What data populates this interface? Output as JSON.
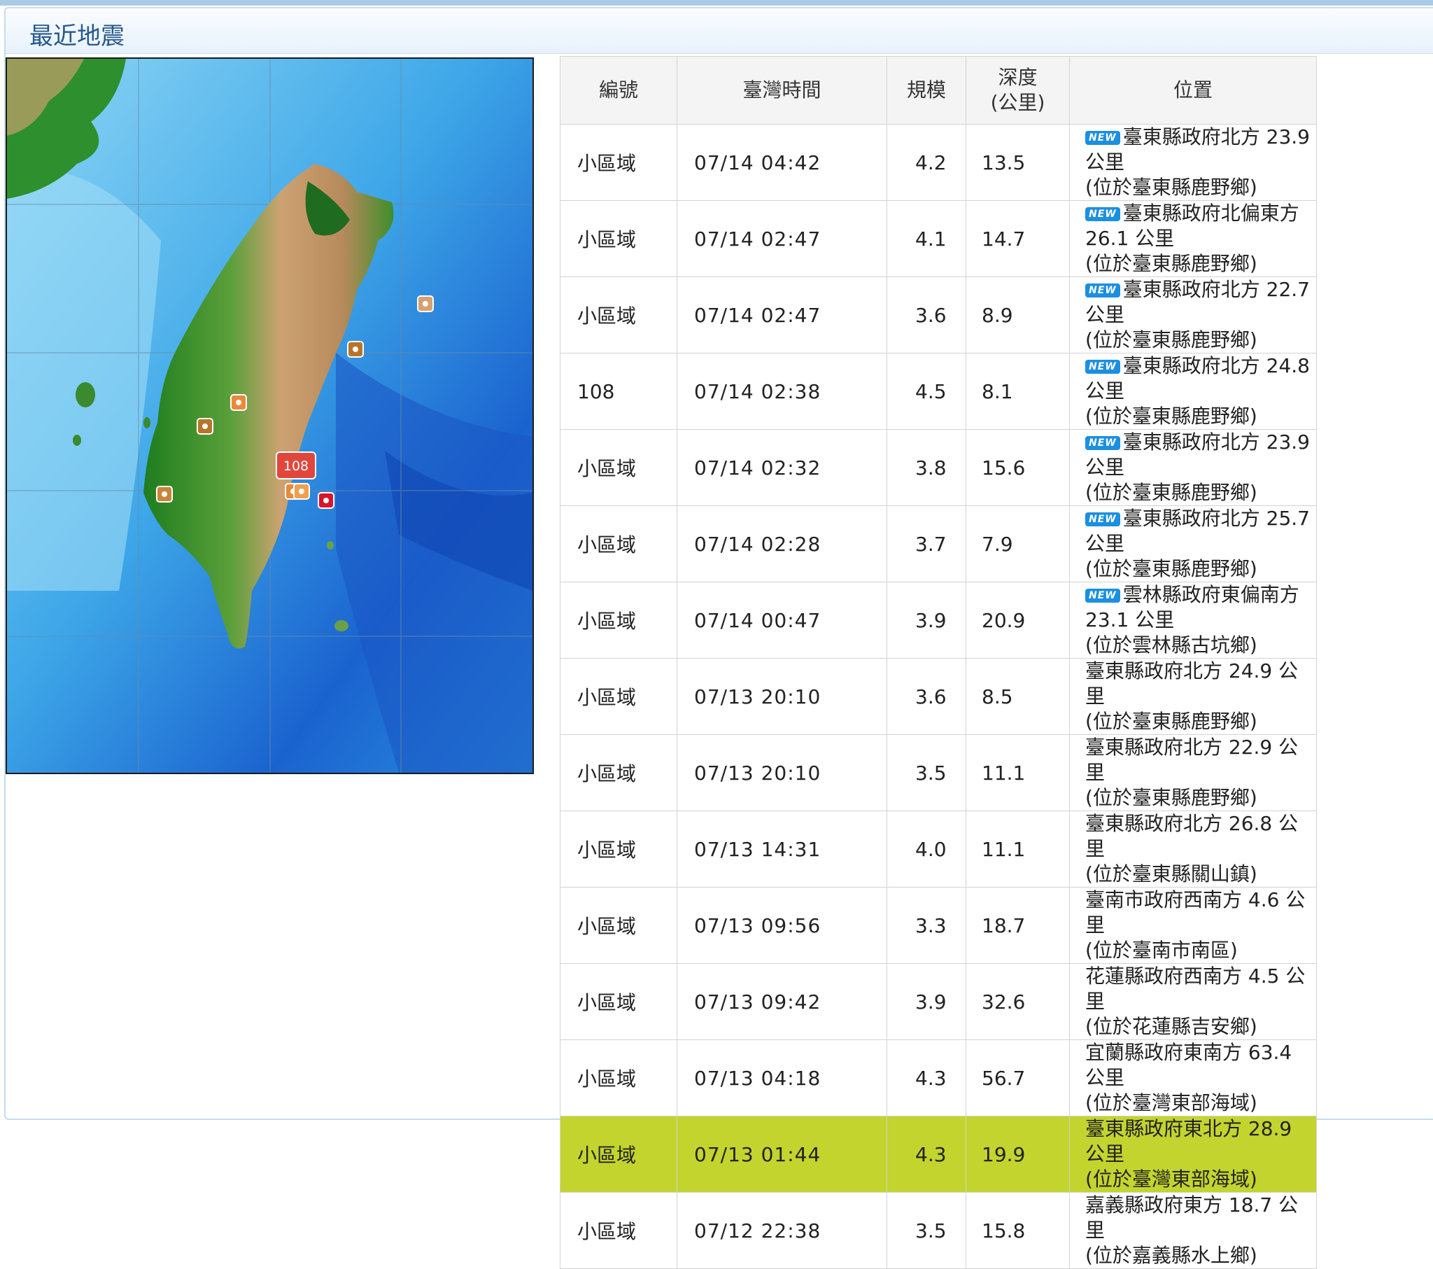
{
  "header": {
    "title": "最近地震"
  },
  "map": {
    "featured_label": "108"
  },
  "table": {
    "columns": {
      "id": "編號",
      "time": "臺灣時間",
      "magnitude": "規模",
      "depth_line1": "深度",
      "depth_line2": "(公里)",
      "location": "位置"
    },
    "badge_label": "NEW",
    "rows": [
      {
        "id": "小區域",
        "time": "07/14 04:42",
        "magnitude": "4.2",
        "depth": "13.5",
        "new": true,
        "location": "臺東縣政府北方 23.9 公里",
        "district": "(位於臺東縣鹿野鄉)"
      },
      {
        "id": "小區域",
        "time": "07/14 02:47",
        "magnitude": "4.1",
        "depth": "14.7",
        "new": true,
        "location": "臺東縣政府北偏東方 26.1 公里",
        "district": "(位於臺東縣鹿野鄉)"
      },
      {
        "id": "小區域",
        "time": "07/14 02:47",
        "magnitude": "3.6",
        "depth": "8.9",
        "new": true,
        "location": "臺東縣政府北方 22.7 公里",
        "district": "(位於臺東縣鹿野鄉)"
      },
      {
        "id": "108",
        "time": "07/14 02:38",
        "magnitude": "4.5",
        "depth": "8.1",
        "new": true,
        "location": "臺東縣政府北方 24.8 公里",
        "district": "(位於臺東縣鹿野鄉)"
      },
      {
        "id": "小區域",
        "time": "07/14 02:32",
        "magnitude": "3.8",
        "depth": "15.6",
        "new": true,
        "location": "臺東縣政府北方 23.9 公里",
        "district": "(位於臺東縣鹿野鄉)"
      },
      {
        "id": "小區域",
        "time": "07/14 02:28",
        "magnitude": "3.7",
        "depth": "7.9",
        "new": true,
        "location": "臺東縣政府北方 25.7 公里",
        "district": "(位於臺東縣鹿野鄉)"
      },
      {
        "id": "小區域",
        "time": "07/14 00:47",
        "magnitude": "3.9",
        "depth": "20.9",
        "new": true,
        "location": "雲林縣政府東偏南方 23.1 公里",
        "district": "(位於雲林縣古坑鄉)"
      },
      {
        "id": "小區域",
        "time": "07/13 20:10",
        "magnitude": "3.6",
        "depth": "8.5",
        "new": false,
        "location": "臺東縣政府北方 24.9 公里",
        "district": "(位於臺東縣鹿野鄉)"
      },
      {
        "id": "小區域",
        "time": "07/13 20:10",
        "magnitude": "3.5",
        "depth": "11.1",
        "new": false,
        "location": "臺東縣政府北方 22.9 公里",
        "district": "(位於臺東縣鹿野鄉)"
      },
      {
        "id": "小區域",
        "time": "07/13 14:31",
        "magnitude": "4.0",
        "depth": "11.1",
        "new": false,
        "location": "臺東縣政府北方 26.8 公里",
        "district": "(位於臺東縣關山鎮)"
      },
      {
        "id": "小區域",
        "time": "07/13 09:56",
        "magnitude": "3.3",
        "depth": "18.7",
        "new": false,
        "location": "臺南市政府西南方 4.6 公里",
        "district": "(位於臺南市南區)"
      },
      {
        "id": "小區域",
        "time": "07/13 09:42",
        "magnitude": "3.9",
        "depth": "32.6",
        "new": false,
        "location": "花蓮縣政府西南方 4.5 公里",
        "district": "(位於花蓮縣吉安鄉)"
      },
      {
        "id": "小區域",
        "time": "07/13 04:18",
        "magnitude": "4.3",
        "depth": "56.7",
        "new": false,
        "location": "宜蘭縣政府東南方 63.4 公里",
        "district": "(位於臺灣東部海域)"
      },
      {
        "id": "小區域",
        "time": "07/13 01:44",
        "magnitude": "4.3",
        "depth": "19.9",
        "new": false,
        "highlighted": true,
        "location": "臺東縣政府東北方 28.9 公里",
        "district": "(位於臺灣東部海域)"
      },
      {
        "id": "小區域",
        "time": "07/12 22:38",
        "magnitude": "3.5",
        "depth": "15.8",
        "new": false,
        "location": "嘉義縣政府東方 18.7 公里",
        "district": "(位於嘉義縣水上鄉)"
      }
    ]
  },
  "colors": {
    "highlight_row": "#c3d42e",
    "badge": "#1b8fe0",
    "header_text": "#26588c",
    "featured_marker": "#e0463c",
    "marker": "#e88a3a",
    "marker_dark": "#b8742a",
    "marker_red": "#d9142b"
  }
}
